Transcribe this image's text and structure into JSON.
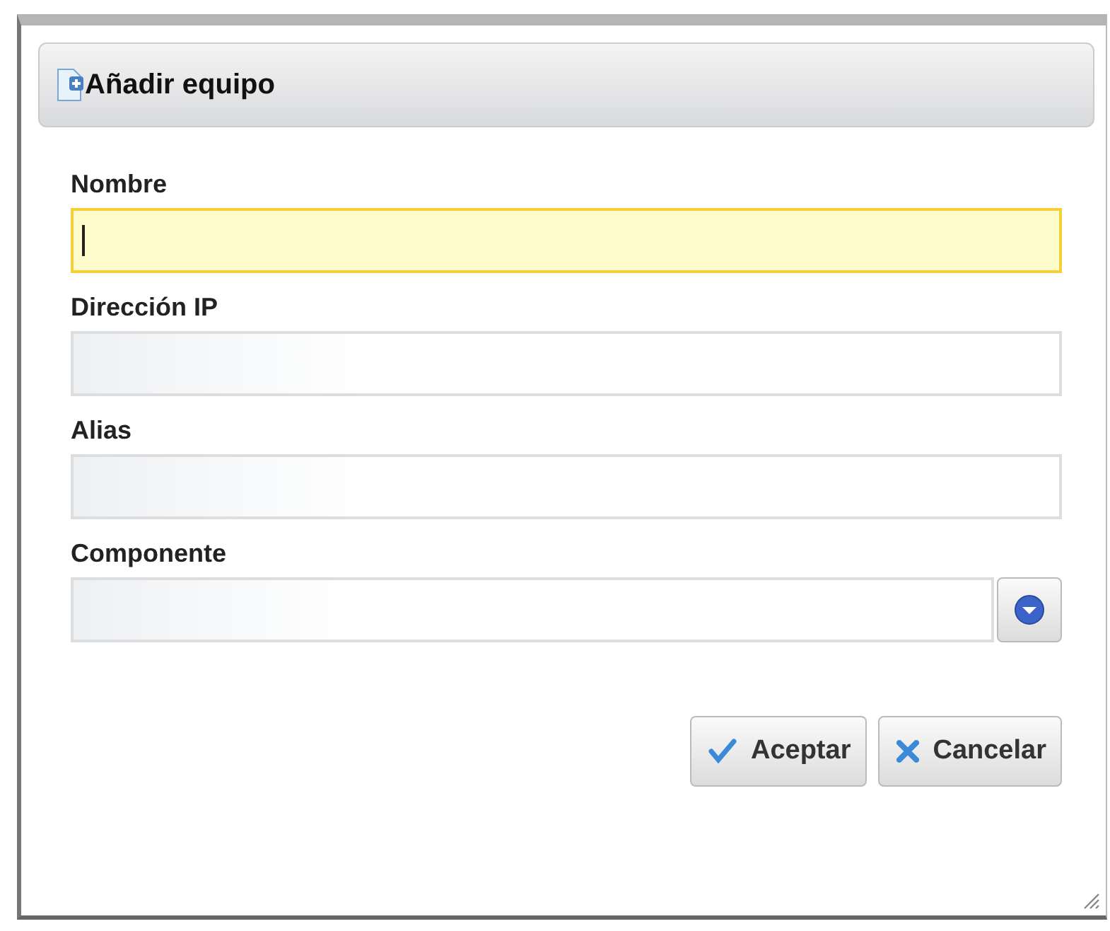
{
  "dialog": {
    "title": "Añadir equipo",
    "fields": [
      {
        "label": "Nombre",
        "kind": "text",
        "focused": true
      },
      {
        "label": "Dirección IP",
        "kind": "text",
        "focused": false
      },
      {
        "label": "Alias",
        "kind": "text",
        "focused": false
      },
      {
        "label": "Componente",
        "kind": "combo",
        "focused": false
      }
    ],
    "buttons": [
      {
        "label": "Aceptar",
        "kind": "accept"
      },
      {
        "label": "Cancelar",
        "kind": "cancel"
      }
    ]
  }
}
